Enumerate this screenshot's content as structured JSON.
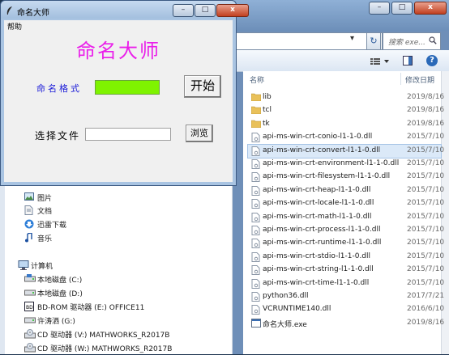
{
  "app": {
    "title": "命名大师",
    "menu": {
      "help": "帮助"
    },
    "heading": "命名大师",
    "format_label": "命名格式",
    "format_color": "#7ff300",
    "start_button": "开始",
    "file_label": "选择文件",
    "file_input_value": "",
    "browse_button": "浏览",
    "caption_buttons": {
      "minimize": "–",
      "maximize": "□",
      "close": "x"
    }
  },
  "explorer": {
    "search_placeholder": "搜索 exe...",
    "columns": {
      "name": "名称",
      "date": "修改日期"
    },
    "files": [
      {
        "name": "lib",
        "date": "2019/8/16",
        "type": "folder"
      },
      {
        "name": "tcl",
        "date": "2019/8/16",
        "type": "folder"
      },
      {
        "name": "tk",
        "date": "2019/8/16",
        "type": "folder"
      },
      {
        "name": "api-ms-win-crt-conio-l1-1-0.dll",
        "date": "2015/7/10",
        "type": "dll"
      },
      {
        "name": "api-ms-win-crt-convert-l1-1-0.dll",
        "date": "2015/7/10",
        "type": "dll",
        "selected": true
      },
      {
        "name": "api-ms-win-crt-environment-l1-1-0.dll",
        "date": "2015/7/10",
        "type": "dll"
      },
      {
        "name": "api-ms-win-crt-filesystem-l1-1-0.dll",
        "date": "2015/7/10",
        "type": "dll"
      },
      {
        "name": "api-ms-win-crt-heap-l1-1-0.dll",
        "date": "2015/7/10",
        "type": "dll"
      },
      {
        "name": "api-ms-win-crt-locale-l1-1-0.dll",
        "date": "2015/7/10",
        "type": "dll"
      },
      {
        "name": "api-ms-win-crt-math-l1-1-0.dll",
        "date": "2015/7/10",
        "type": "dll"
      },
      {
        "name": "api-ms-win-crt-process-l1-1-0.dll",
        "date": "2015/7/10",
        "type": "dll"
      },
      {
        "name": "api-ms-win-crt-runtime-l1-1-0.dll",
        "date": "2015/7/10",
        "type": "dll"
      },
      {
        "name": "api-ms-win-crt-stdio-l1-1-0.dll",
        "date": "2015/7/10",
        "type": "dll"
      },
      {
        "name": "api-ms-win-crt-string-l1-1-0.dll",
        "date": "2015/7/10",
        "type": "dll"
      },
      {
        "name": "api-ms-win-crt-time-l1-1-0.dll",
        "date": "2015/7/10",
        "type": "dll"
      },
      {
        "name": "python36.dll",
        "date": "2017/7/21",
        "type": "dll"
      },
      {
        "name": "VCRUNTIME140.dll",
        "date": "2016/6/10",
        "type": "dll"
      },
      {
        "name": "命名大师.exe",
        "date": "2019/8/16",
        "type": "exe"
      }
    ],
    "nav": [
      {
        "label": "图片",
        "icon": "pictures-icon"
      },
      {
        "label": "文档",
        "icon": "documents-icon"
      },
      {
        "label": "迅雷下载",
        "icon": "download-icon"
      },
      {
        "label": "音乐",
        "icon": "music-icon"
      },
      {
        "label": "计算机",
        "icon": "computer-icon"
      },
      {
        "label": "本地磁盘 (C:)",
        "icon": "drive-c-icon"
      },
      {
        "label": "本地磁盘 (D:)",
        "icon": "drive-icon"
      },
      {
        "label": "BD-ROM 驱动器 (E:) OFFICE11",
        "icon": "bd-rom-icon"
      },
      {
        "label": "许涛洒 (G:)",
        "icon": "drive-icon"
      },
      {
        "label": "CD 驱动器 (V:) MATHWORKS_R2017B",
        "icon": "cd-drive-icon"
      },
      {
        "label": "CD 驱动器 (W:) MATHWORKS_R2017B",
        "icon": "cd-drive-icon"
      }
    ]
  }
}
